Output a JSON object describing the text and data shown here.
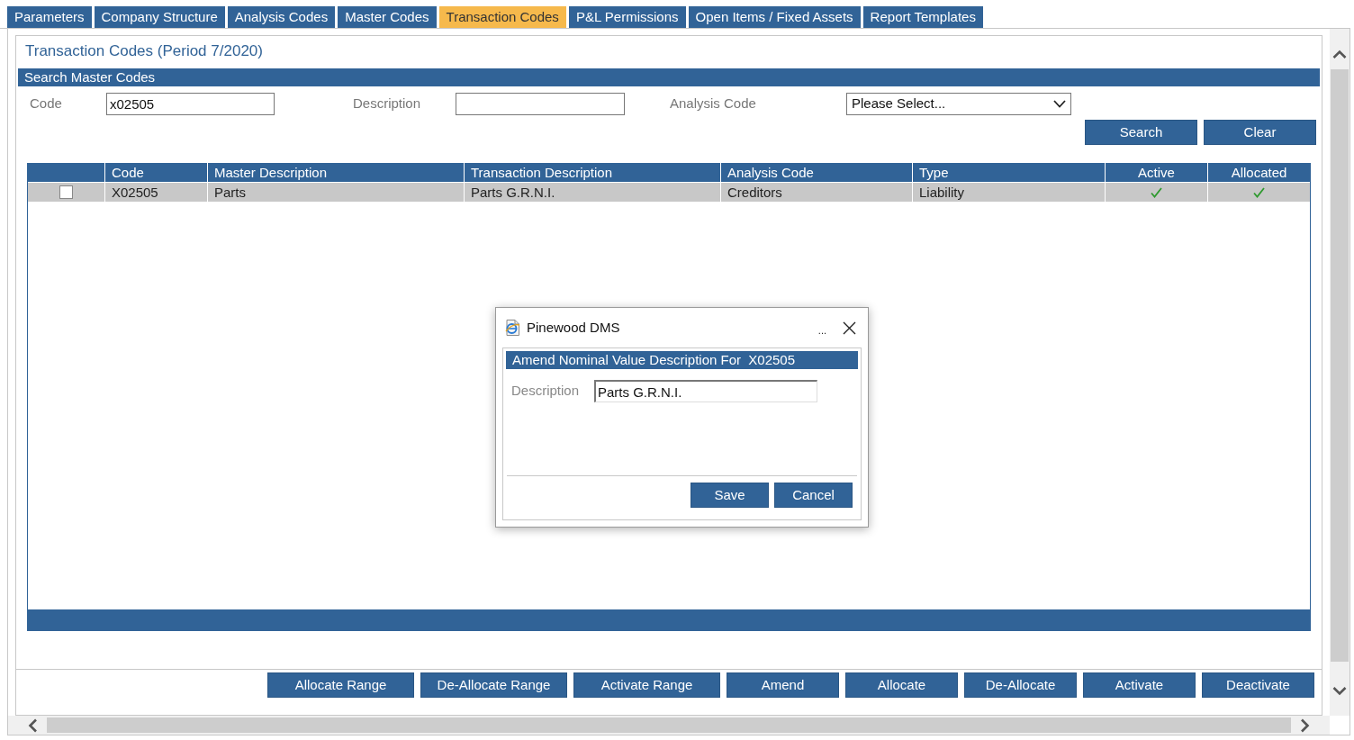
{
  "tabs": [
    {
      "label": "Parameters",
      "selected": false
    },
    {
      "label": "Company Structure",
      "selected": false
    },
    {
      "label": "Analysis Codes",
      "selected": false
    },
    {
      "label": "Master Codes",
      "selected": false
    },
    {
      "label": "Transaction Codes",
      "selected": true
    },
    {
      "label": "P&L Permissions",
      "selected": false
    },
    {
      "label": "Open Items / Fixed Assets",
      "selected": false
    },
    {
      "label": "Report Templates",
      "selected": false
    }
  ],
  "page_title": "Transaction Codes (Period 7/2020)",
  "search": {
    "title": "Search Master Codes",
    "fields": [
      {
        "kind": "text",
        "label": "Code",
        "value": "x02505"
      },
      {
        "kind": "text",
        "label": "Description"
      },
      {
        "kind": "select",
        "label": "Analysis Code",
        "value": "Please Select..."
      }
    ],
    "buttons": [
      "Search",
      "Clear"
    ]
  },
  "table": {
    "columns": [
      {
        "label": "Code",
        "kind": "text"
      },
      {
        "label": "Master Description",
        "kind": "text"
      },
      {
        "label": "Transaction Description",
        "kind": "text"
      },
      {
        "label": "Analysis Code",
        "kind": "text"
      },
      {
        "label": "Type",
        "kind": "text"
      },
      {
        "label": "Active",
        "kind": "tick"
      },
      {
        "label": "Allocated",
        "kind": "tick"
      }
    ],
    "rows": [
      {
        "checked": false,
        "cells": [
          "X02505",
          "Parts",
          "Parts G.R.N.I.",
          "Creditors",
          "Liability",
          true,
          true
        ]
      }
    ]
  },
  "actions": [
    "Allocate Range",
    "De-Allocate Range",
    "Activate Range",
    "Amend",
    "Allocate",
    "De-Allocate",
    "Activate",
    "Deactivate"
  ],
  "dialog": {
    "title": "Pinewood DMS",
    "more": "...",
    "header": "Amend Nominal Value Description For  X02505",
    "field": {
      "label": "Description",
      "value": "Parts G.R.N.I."
    },
    "buttons": [
      "Save",
      "Cancel"
    ]
  }
}
